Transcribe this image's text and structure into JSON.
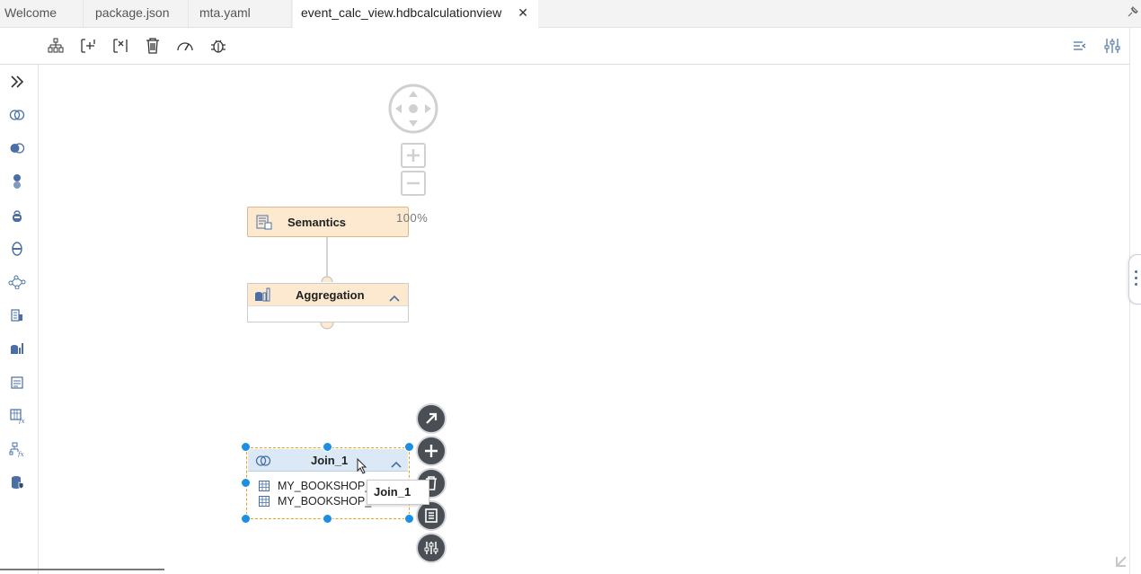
{
  "tabs": [
    {
      "label": "Welcome"
    },
    {
      "label": "package.json"
    },
    {
      "label": "mta.yaml"
    },
    {
      "label": "event_calc_view.hdbcalculationview",
      "active": true
    }
  ],
  "toolbar": {
    "left_icons": [
      "hierarchy-icon",
      "add-source-icon",
      "remove-node-icon",
      "delete-icon",
      "performance-icon",
      "debug-icon"
    ],
    "right_icons": [
      "collapse-icon",
      "settings-icon"
    ]
  },
  "palette": {
    "icons": [
      "join-icon",
      "star-join-icon",
      "union-icon",
      "projection-icon",
      "aggregation-node-icon",
      "graph-icon",
      "rank-icon",
      "table-function-icon",
      "minus-icon",
      "intersect-icon",
      "non-equi-join-icon",
      "hierarchy-function-icon",
      "anonymize-icon"
    ]
  },
  "canvas": {
    "zoom_label": "100%",
    "nodes": {
      "semantics": {
        "label": "Semantics"
      },
      "aggregation": {
        "label": "Aggregation"
      },
      "join": {
        "label": "Join_1",
        "rows": [
          "MY_BOOKSHOP_BOOKS",
          "MY_BOOKSHOP_AUTHORS"
        ]
      }
    },
    "tooltip": "Join_1"
  },
  "colors": {
    "node_orange": "#fce9cf",
    "node_blue": "#dbe9f7",
    "selection": "#1a8fe3",
    "action_button": "#4a4f55"
  }
}
